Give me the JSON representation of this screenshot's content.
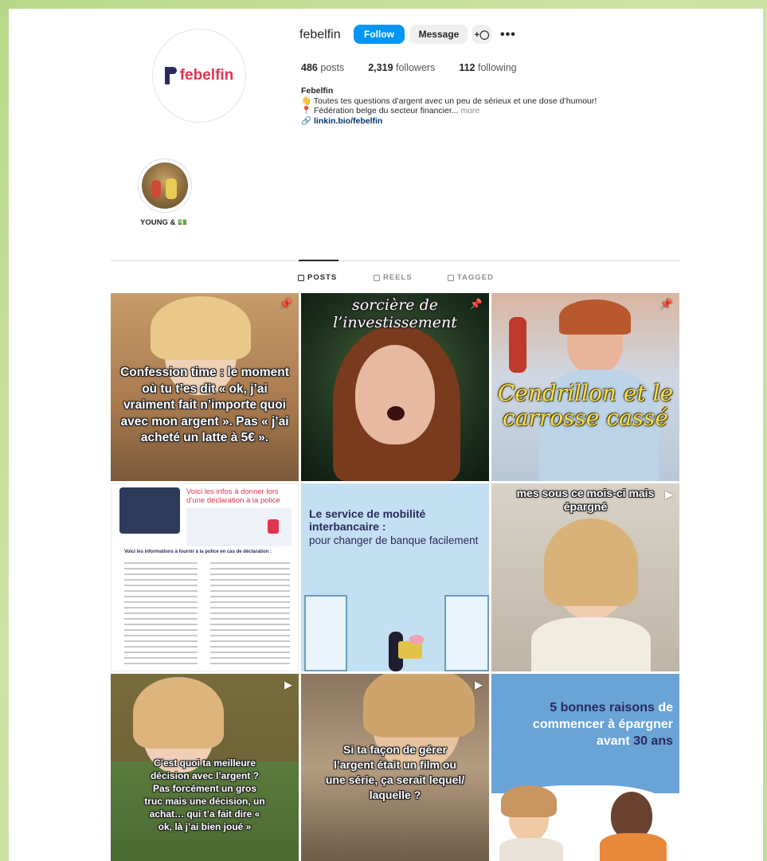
{
  "profile": {
    "username": "febelfin",
    "logo_text": "febelfin",
    "follow_label": "Follow",
    "message_label": "Message",
    "add_user_icon": "add-person",
    "more_icon": "•••",
    "stats": {
      "posts_count": "486",
      "posts_label": "posts",
      "followers_count": "2,319",
      "followers_label": "followers",
      "following_count": "112",
      "following_label": "following"
    },
    "bio": {
      "name": "Febelfin",
      "line1": "👋 Toutes tes questions d’argent avec un peu de sérieux et une dose d’humour!",
      "line2": "📍 Fédération belge du secteur financier...",
      "more": "more",
      "link": "🔗 linkin.bio/febelfin"
    }
  },
  "highlight": {
    "label": "YOUNG & 💵"
  },
  "tabs": [
    {
      "label": "POSTS",
      "icon": "grid-icon",
      "active": true
    },
    {
      "label": "REELS",
      "icon": "reels-icon",
      "active": false
    },
    {
      "label": "TAGGED",
      "icon": "tagged-icon",
      "active": false
    }
  ],
  "posts": [
    {
      "caption": "Confession time : le moment où tu t’es dit « ok, j’ai vraiment fait n’importe quoi avec mon argent ». Pas « j’ai acheté un latte à 5€ ».",
      "badge": "pin"
    },
    {
      "caption": "sorcière de l’investissement",
      "badge": "pin"
    },
    {
      "caption": "Cendrillon et le carrosse cassé",
      "badge": "pin"
    },
    {
      "title": "Voici les infos à donner lors d’une déclaration à la police",
      "subtitle": "Voici les informations à fournir à la police en cas de déclaration :",
      "badge": ""
    },
    {
      "title": "Le service de mobilité interbancaire :",
      "subtitle": "pour changer de banque facilement",
      "badge": ""
    },
    {
      "caption": "mes sous ce mois-ci mais épargné",
      "badge": "reel"
    },
    {
      "caption": "C’est quoi ta meilleure décision avec l’argent ? Pas forcément un gros truc mais une décision, un achat… qui t’a fait dire « ok, là j’ai bien joué »",
      "badge": "reel"
    },
    {
      "caption": "Si ta façon de gérer l’argent était un film ou une série, ça serait lequel/ laquelle ?",
      "badge": "reel"
    },
    {
      "title_part1": "5 bonnes raisons",
      "title_part2": " de commencer à épargner avant ",
      "title_part3": "30 ans",
      "badge": ""
    }
  ]
}
